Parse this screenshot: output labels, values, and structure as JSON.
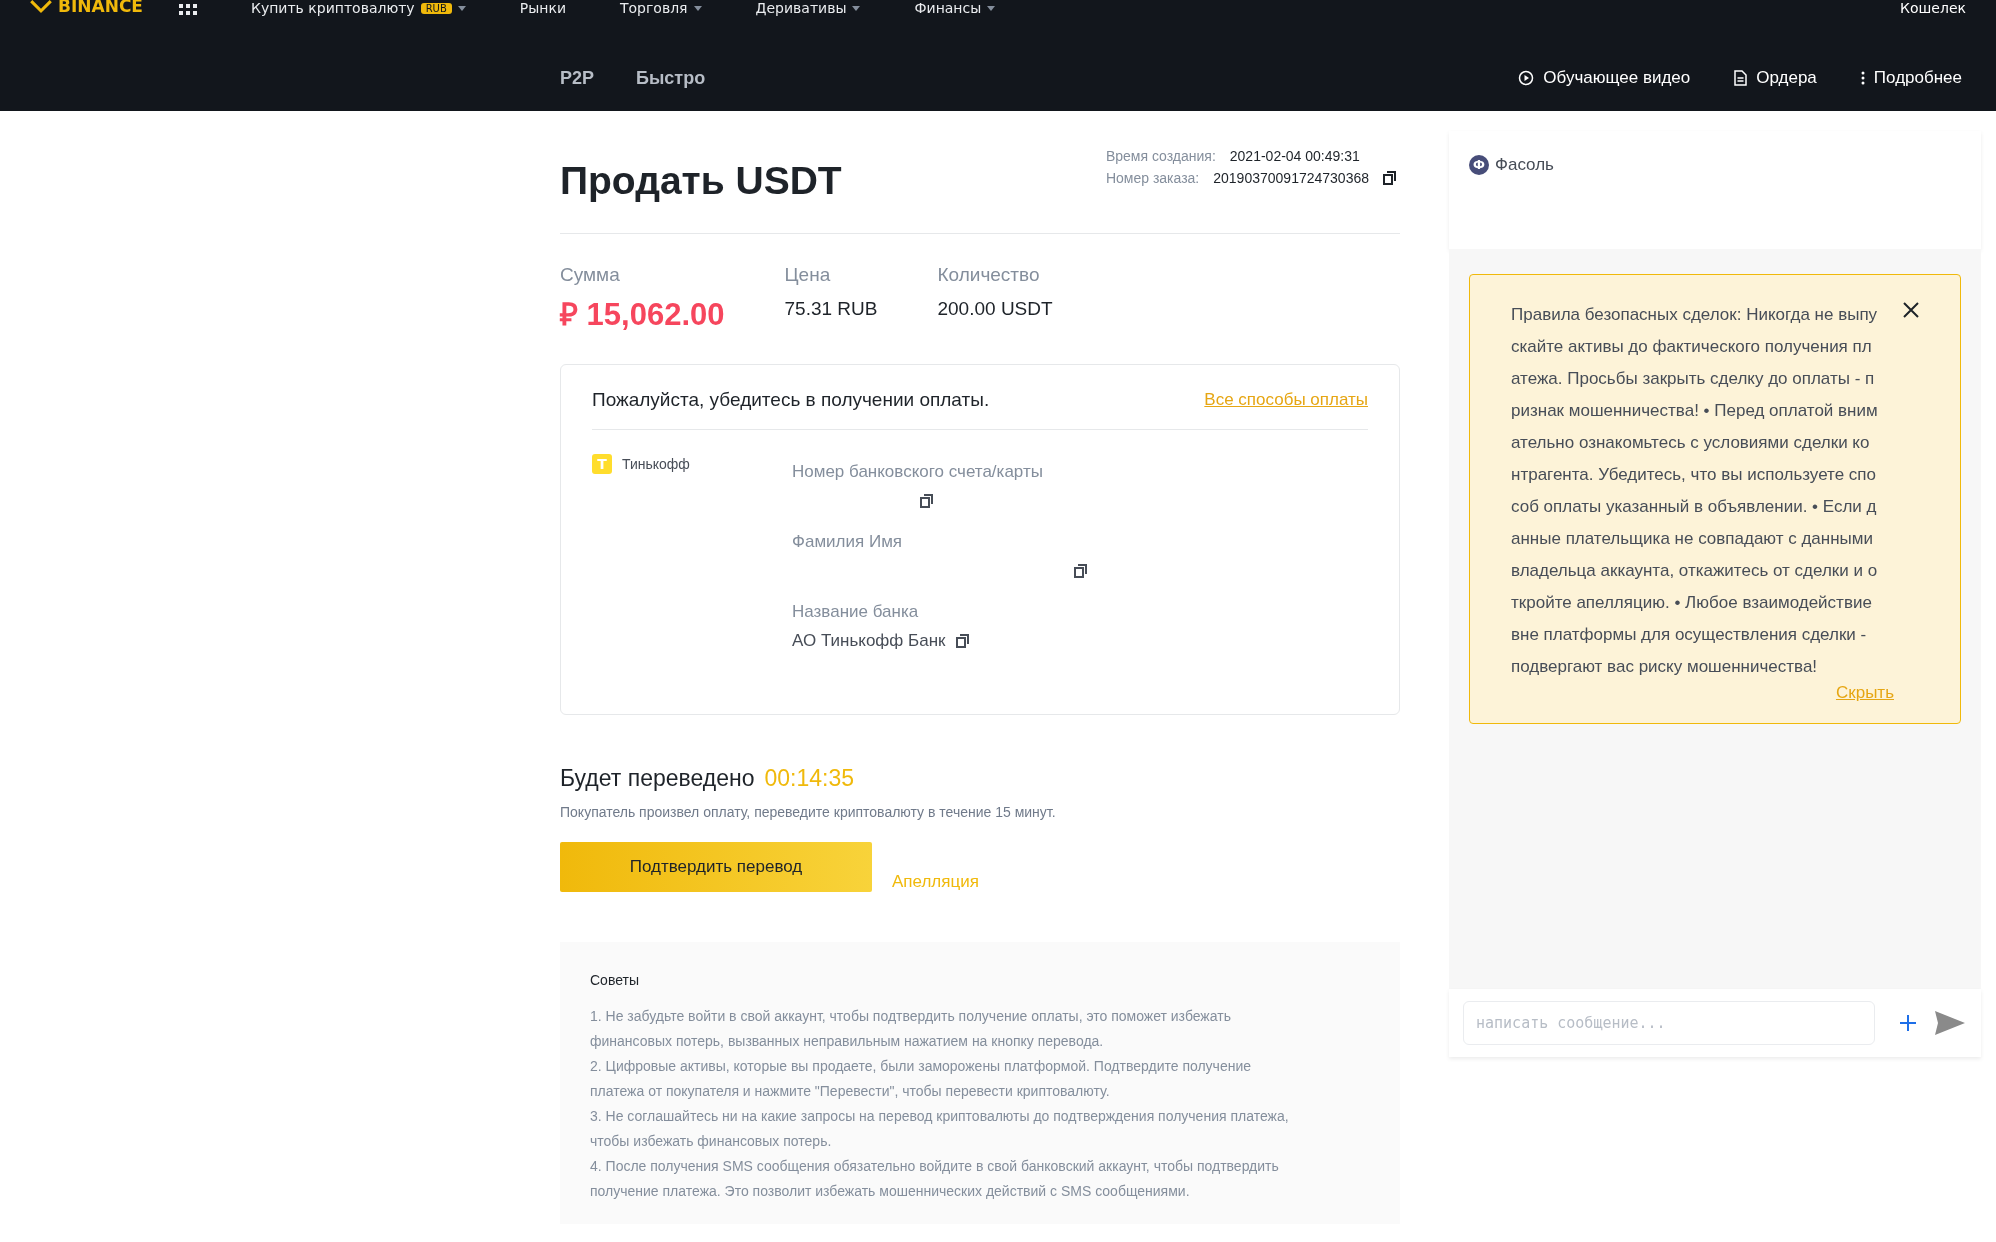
{
  "top_nav": {
    "logo": "BINANCE",
    "items": [
      {
        "label": "Купить криптовалюту",
        "badge": "RUB",
        "dropdown": true
      },
      {
        "label": "Рынки",
        "dropdown": false
      },
      {
        "label": "Торговля",
        "dropdown": true
      },
      {
        "label": "Деривативы",
        "dropdown": true
      },
      {
        "label": "Финансы",
        "dropdown": true
      }
    ],
    "right": "Кошелек"
  },
  "sub_nav": {
    "tabs": [
      "P2P",
      "Быстро"
    ],
    "links": [
      {
        "kind": "play",
        "label": "Обучающее видео"
      },
      {
        "kind": "doc",
        "label": "Ордера"
      },
      {
        "kind": "more",
        "label": "Подробнее"
      }
    ]
  },
  "order": {
    "title": "Продать USDT",
    "created_label": "Время создания:",
    "created_value": "2021-02-04 00:49:31",
    "number_label": "Номер заказа:",
    "number_value": "20190370091724730368",
    "summary": [
      {
        "label": "Сумма",
        "value": "₽ 15,062.00",
        "kind": "amount"
      },
      {
        "label": "Цена",
        "value": "75.31 RUB",
        "kind": "plain"
      },
      {
        "label": "Количество",
        "value": "200.00 USDT",
        "kind": "plain"
      }
    ]
  },
  "payment": {
    "heading": "Пожалуйста, убедитесь в получении оплаты.",
    "all_methods": "Все способы оплаты",
    "method": "Тинькофф",
    "method_icon": "T",
    "fields": [
      {
        "label": "Номер банковского счета/карты"
      },
      {
        "label": "Фамилия Имя"
      },
      {
        "label": "Название банка",
        "value": "АО Тинькофф Банк"
      }
    ]
  },
  "transfer": {
    "label": "Будет переведено",
    "timer": "00:14:35",
    "note": "Покупатель произвел оплату, переведите криптовалюту в течение 15 минут.",
    "confirm": "Подтвердить перевод",
    "appeal": "Апелляция"
  },
  "tips": {
    "title": "Советы",
    "items": [
      "1. Не забудьте войти в свой аккаунт, чтобы подтвердить получение оплаты, это поможет избежать финансовых потерь, вызванных неправильным нажатием на кнопку перевода.",
      "2. Цифровые активы, которые вы продаете, были заморожены платформой. Подтвердите получение платежа от покупателя и нажмите \"Перевести\", чтобы перевести криптовалюту.",
      "3. Не соглашайтесь ни на какие запросы на перевод криптовалюты до подтверждения получения платежа, чтобы избежать финансовых потерь.",
      "4. После получения SMS сообщения обязательно войдите в свой банковский аккаунт, чтобы подтвердить получение платежа. Это позволит избежать мошеннических действий с SMS сообщениями."
    ]
  },
  "seller": {
    "avatar": "Ф",
    "name": "Фасоль"
  },
  "warning": {
    "text": "Правила безопасных сделок: Никогда не выпускайте активы до фактического получения платежа. Просьбы закрыть сделку до оплаты - признак мошенничества! • Перед оплатой внимательно ознакомьтесь с условиями сделки контрагента. Убедитесь, что вы используете способ оплаты указанный в объявлении. • Если данные плательщика не совпадают с данными владельца аккаунта, откажитесь от сделки и откройте апелляцию. • Любое взаимодействие вне платформы для осуществления сделки - подвергают вас риску мошенничества!",
    "hide": "Скрыть"
  },
  "chat": {
    "placeholder": "написать сообщение..."
  }
}
